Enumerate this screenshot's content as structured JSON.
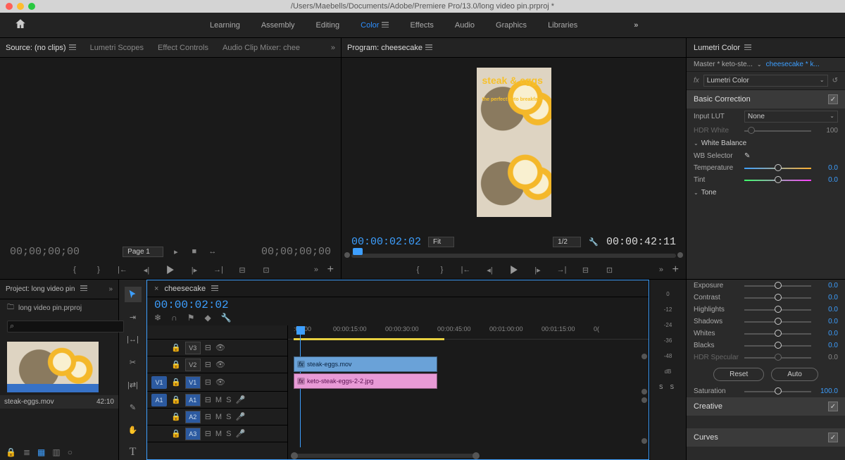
{
  "title_path": "/Users/Maebells/Documents/Adobe/Premiere Pro/13.0/long video pin.prproj *",
  "workspaces": [
    "Learning",
    "Assembly",
    "Editing",
    "Color",
    "Effects",
    "Audio",
    "Graphics",
    "Libraries"
  ],
  "active_workspace": "Color",
  "source_tabs": {
    "source": "Source: (no clips)",
    "lumetri_scopes": "Lumetri Scopes",
    "effect_controls": "Effect Controls",
    "audio_mixer": "Audio Clip Mixer: chee"
  },
  "source_foot": {
    "tc_left": "00;00;00;00",
    "page": "Page 1",
    "tc_right": "00;00;00;00"
  },
  "program": {
    "title": "Program: cheesecake",
    "cap_title": "steak & eggs",
    "cap_sub": "the perfect keto breakfast",
    "tc_current": "00:00:02:02",
    "zoom": "Fit",
    "res": "1/2",
    "duration": "00:00:42:11"
  },
  "lumetri": {
    "panel": "Lumetri Color",
    "master": "Master * keto-ste...",
    "clip": "cheesecake * k...",
    "effect": "Lumetri Color",
    "basic": "Basic Correction",
    "input_lut_label": "Input LUT",
    "input_lut": "None",
    "hdr_white": "HDR White",
    "hdr_white_val": "100",
    "wb": "White Balance",
    "wb_selector": "WB Selector",
    "temperature": "Temperature",
    "temperature_val": "0.0",
    "tint": "Tint",
    "tint_val": "0.0",
    "tone": "Tone",
    "exposure": "Exposure",
    "exposure_val": "0.0",
    "contrast": "Contrast",
    "contrast_val": "0.0",
    "highlights": "Highlights",
    "highlights_val": "0.0",
    "shadows": "Shadows",
    "shadows_val": "0.0",
    "whites": "Whites",
    "whites_val": "0.0",
    "blacks": "Blacks",
    "blacks_val": "0.0",
    "hdr_spec": "HDR Specular",
    "hdr_spec_val": "0.0",
    "reset": "Reset",
    "auto": "Auto",
    "saturation": "Saturation",
    "saturation_val": "100.0",
    "creative": "Creative",
    "curves": "Curves"
  },
  "project": {
    "title": "Project: long video pin",
    "bin": "long video pin.prproj",
    "clip_name": "steak-eggs.mov",
    "clip_dur": "42:10"
  },
  "timeline": {
    "seq": "cheesecake",
    "tc": "00:00:02:02",
    "ruler": [
      ":00:00",
      "00:00:15:00",
      "00:00:30:00",
      "00:00:45:00",
      "00:01:00:00",
      "00:01:15:00",
      "0("
    ],
    "tracks": {
      "v3": "V3",
      "v2": "V2",
      "v1": "V1",
      "a1": "A1",
      "a2": "A2",
      "a3": "A3"
    },
    "clip_v2": "steak-eggs.mov",
    "clip_v1": "keto-steak-eggs-2-2.jpg",
    "m": "M",
    "s": "S",
    "fx": "fx"
  },
  "meters": {
    "scale": [
      "0",
      "-12",
      "-24",
      "-36",
      "-48",
      "dB"
    ],
    "solo": "S S"
  }
}
